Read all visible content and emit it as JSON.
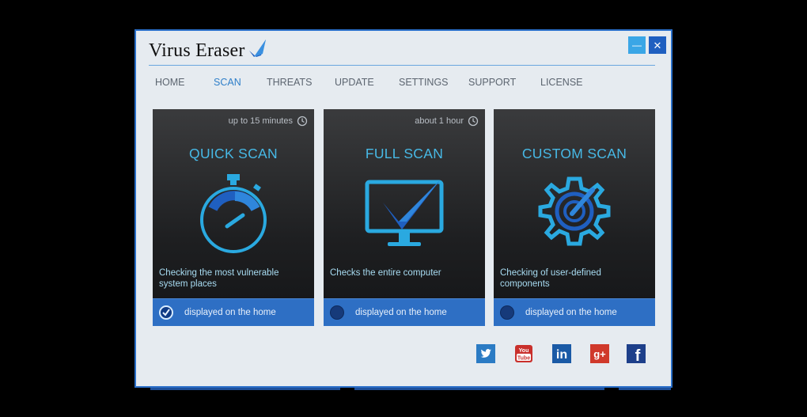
{
  "app": {
    "title": "Virus Eraser",
    "minimize_label": "—",
    "close_label": "✕"
  },
  "nav": {
    "items": [
      {
        "label": "HOME"
      },
      {
        "label": "SCAN",
        "active": true
      },
      {
        "label": "THREATS"
      },
      {
        "label": "UPDATE"
      },
      {
        "label": "SETTINGS"
      },
      {
        "label": "SUPPORT"
      },
      {
        "label": "LICENSE"
      }
    ]
  },
  "cards": [
    {
      "time": "up to 15 minutes",
      "title": "QUICK SCAN",
      "description": "Checking the most vulnerable system places",
      "footer_label": "displayed on the home",
      "checked": true
    },
    {
      "time": "about 1 hour",
      "title": "FULL SCAN",
      "description": "Checks the entire computer",
      "footer_label": "displayed on the home",
      "checked": false
    },
    {
      "time": "",
      "title": "CUSTOM SCAN",
      "description": "Checking of user-defined components",
      "footer_label": "displayed on the home",
      "checked": false
    }
  ],
  "social": [
    {
      "icon": "twitter-icon",
      "color": "#2b7bc4"
    },
    {
      "icon": "youtube-icon",
      "color": "#c9302c",
      "text_top": "You",
      "text_bottom": "Tube"
    },
    {
      "icon": "linkedin-icon",
      "color": "#1a5aa6",
      "text": "in"
    },
    {
      "icon": "googleplus-icon",
      "color": "#d0392b",
      "text": "g+"
    },
    {
      "icon": "facebook-icon",
      "color": "#1d3f8a",
      "text": "f"
    }
  ],
  "colors": {
    "accent": "#47b9e6",
    "card_footer": "#2e6fc4",
    "window_border": "#2a6fc9"
  }
}
